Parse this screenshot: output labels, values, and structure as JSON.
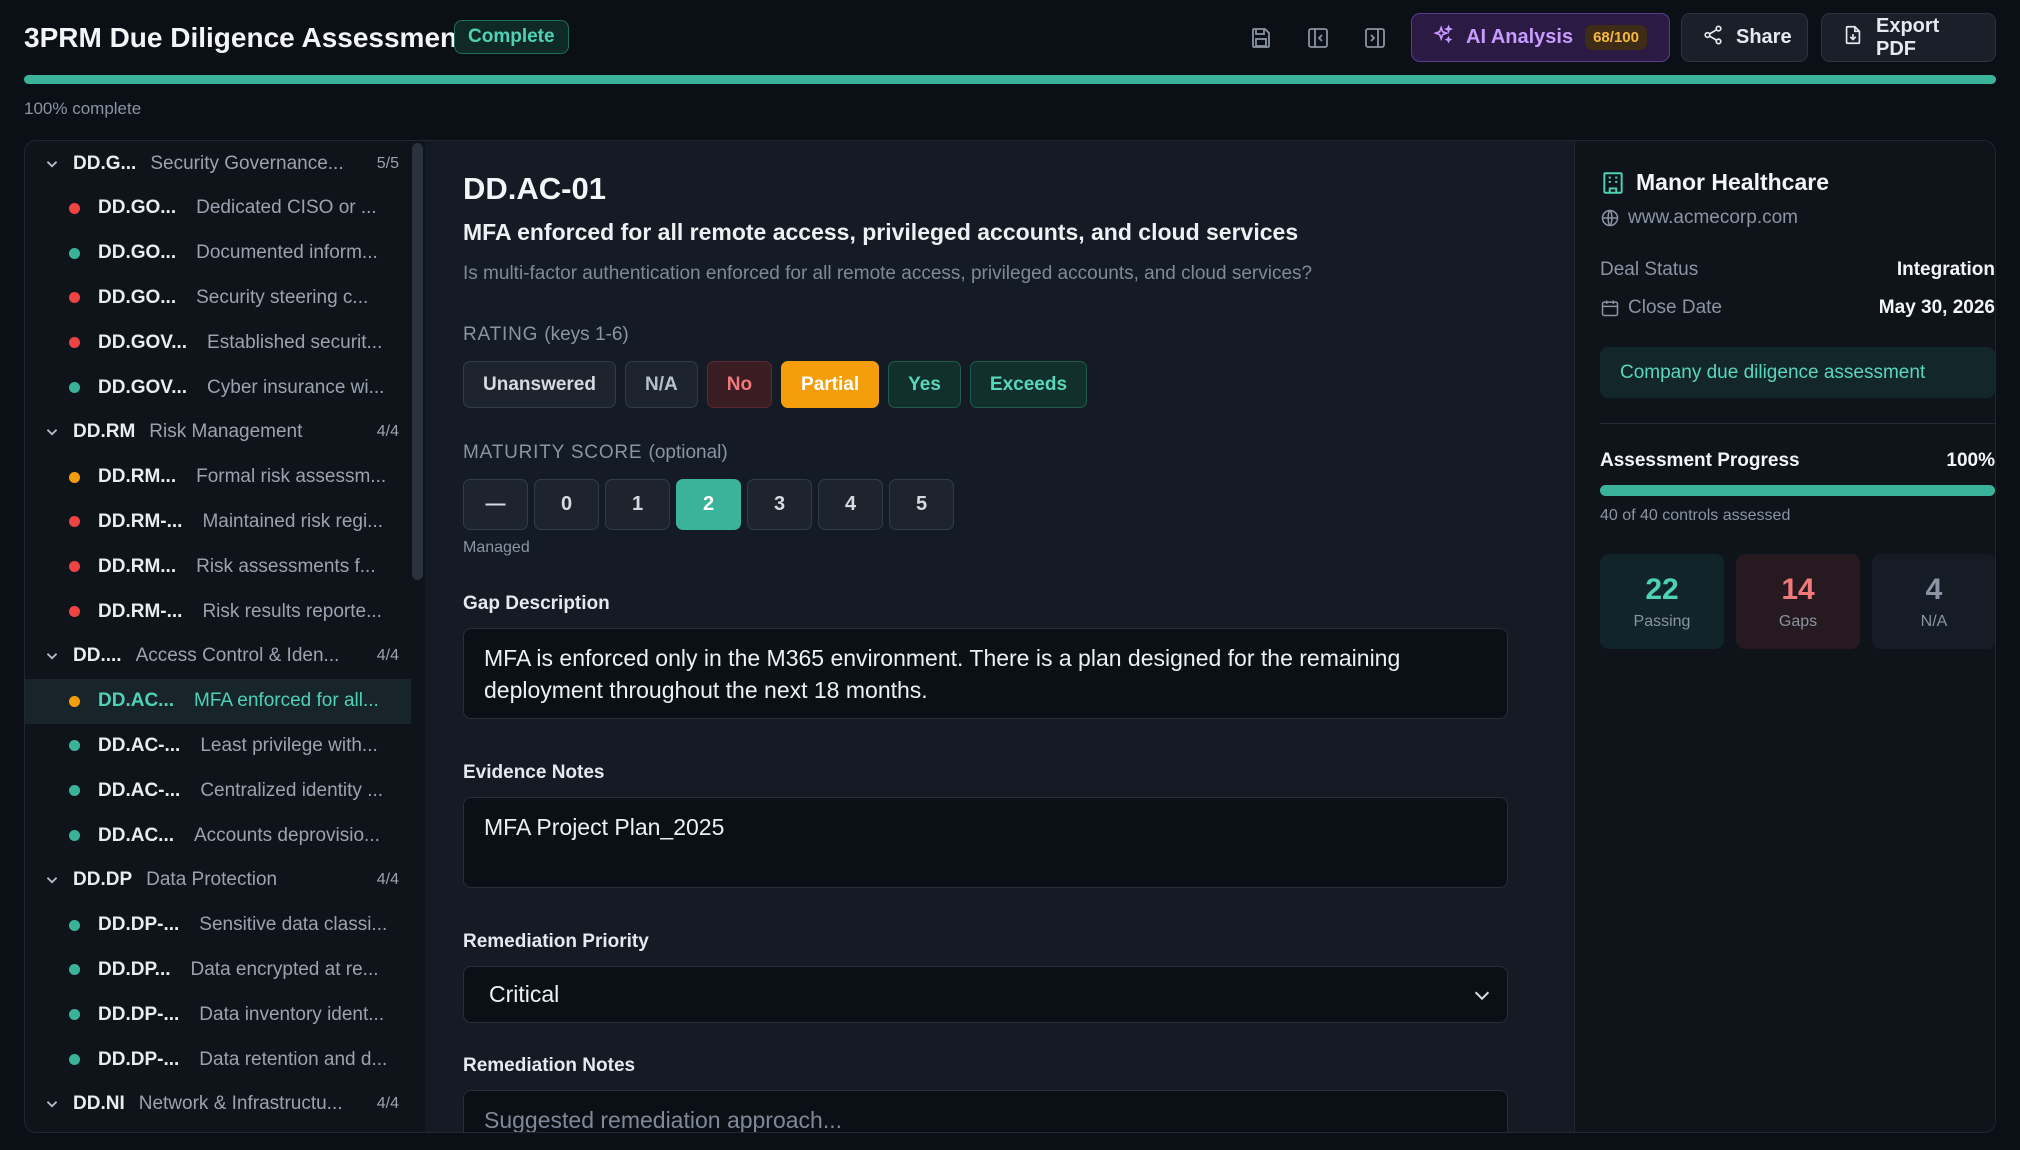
{
  "header": {
    "title": "3PRM Due Diligence Assessment",
    "status": "Complete",
    "ai_label": "AI Analysis",
    "ai_score": "68/100",
    "share_label": "Share",
    "export_label": "Export PDF",
    "progress_percent": 100,
    "progress_label": "100% complete",
    "icons": [
      "save-icon",
      "collapse-left-icon",
      "collapse-right-icon"
    ]
  },
  "sidebar": {
    "rows": [
      {
        "type": "group",
        "code": "DD.G...",
        "name": "Security Governance...",
        "count": "5/5"
      },
      {
        "type": "item",
        "code": "DD.GO...",
        "name": "Dedicated CISO or ...",
        "status": "gap"
      },
      {
        "type": "item",
        "code": "DD.GO...",
        "name": "Documented inform...",
        "status": "pass"
      },
      {
        "type": "item",
        "code": "DD.GO...",
        "name": "Security steering c...",
        "status": "gap"
      },
      {
        "type": "item",
        "code": "DD.GOV...",
        "name": "Established securit...",
        "status": "gap"
      },
      {
        "type": "item",
        "code": "DD.GOV...",
        "name": "Cyber insurance wi...",
        "status": "pass"
      },
      {
        "type": "group",
        "code": "DD.RM",
        "name": "Risk Management",
        "count": "4/4"
      },
      {
        "type": "item",
        "code": "DD.RM...",
        "name": "Formal risk assessm...",
        "status": "partial"
      },
      {
        "type": "item",
        "code": "DD.RM-...",
        "name": "Maintained risk regi...",
        "status": "gap"
      },
      {
        "type": "item",
        "code": "DD.RM...",
        "name": "Risk assessments f...",
        "status": "gap"
      },
      {
        "type": "item",
        "code": "DD.RM-...",
        "name": "Risk results reporte...",
        "status": "gap"
      },
      {
        "type": "group",
        "code": "DD....",
        "name": "Access Control & Iden...",
        "count": "4/4"
      },
      {
        "type": "item",
        "code": "DD.AC...",
        "name": "MFA enforced for all...",
        "status": "partial",
        "selected": true
      },
      {
        "type": "item",
        "code": "DD.AC-...",
        "name": "Least privilege with...",
        "status": "pass"
      },
      {
        "type": "item",
        "code": "DD.AC-...",
        "name": "Centralized identity ...",
        "status": "pass"
      },
      {
        "type": "item",
        "code": "DD.AC...",
        "name": "Accounts deprovisio...",
        "status": "pass"
      },
      {
        "type": "group",
        "code": "DD.DP",
        "name": "Data Protection",
        "count": "4/4"
      },
      {
        "type": "item",
        "code": "DD.DP-...",
        "name": "Sensitive data classi...",
        "status": "pass"
      },
      {
        "type": "item",
        "code": "DD.DP...",
        "name": "Data encrypted at re...",
        "status": "pass"
      },
      {
        "type": "item",
        "code": "DD.DP-...",
        "name": "Data inventory ident...",
        "status": "pass"
      },
      {
        "type": "item",
        "code": "DD.DP-...",
        "name": "Data retention and d...",
        "status": "pass"
      },
      {
        "type": "group",
        "code": "DD.NI",
        "name": "Network & Infrastructu...",
        "count": "4/4"
      }
    ],
    "status_colors": {
      "gap": "#ef4444",
      "pass": "#3bb39a",
      "partial": "#f59e0b"
    }
  },
  "control": {
    "id": "DD.AC-01",
    "title": "MFA enforced for all remote access, privileged accounts, and cloud services",
    "question": "Is multi-factor authentication enforced for all remote access, privileged accounts, and cloud services?",
    "rating_label": "RATING",
    "rating_hint": "(keys 1-6)",
    "rating_options": [
      "Unanswered",
      "N/A",
      "No",
      "Partial",
      "Yes",
      "Exceeds"
    ],
    "rating_selected": "Partial",
    "maturity_label": "MATURITY SCORE",
    "maturity_hint": "(optional)",
    "maturity_options": [
      "—",
      "0",
      "1",
      "2",
      "3",
      "4",
      "5"
    ],
    "maturity_selected": "2",
    "maturity_caption": "Managed",
    "gap_label": "Gap Description",
    "gap_value": "MFA is enforced only in the M365 environment. There is a plan designed for the remaining deployment throughout the next 18 months.",
    "evidence_label": "Evidence Notes",
    "evidence_value": "MFA Project Plan_2025",
    "priority_label": "Remediation Priority",
    "priority_value": "Critical",
    "remediation_label": "Remediation Notes",
    "remediation_placeholder": "Suggested remediation approach..."
  },
  "company": {
    "name": "Manor Healthcare",
    "website": "www.acmecorp.com",
    "deal_status_label": "Deal Status",
    "deal_status": "Integration",
    "close_date_label": "Close Date",
    "close_date": "May 30, 2026",
    "description": "Company due diligence assessment",
    "progress_title": "Assessment Progress",
    "progress_value": "100%",
    "progress_percent": 100,
    "progress_caption": "40 of 40 controls assessed",
    "stats": {
      "passing": {
        "value": "22",
        "label": "Passing"
      },
      "gaps": {
        "value": "14",
        "label": "Gaps"
      },
      "na": {
        "value": "4",
        "label": "N/A"
      }
    }
  },
  "colors": {
    "accent": "#3bb39a",
    "partial": "#f59e0b",
    "gap": "#ef4444",
    "ai": "#c89bff"
  }
}
